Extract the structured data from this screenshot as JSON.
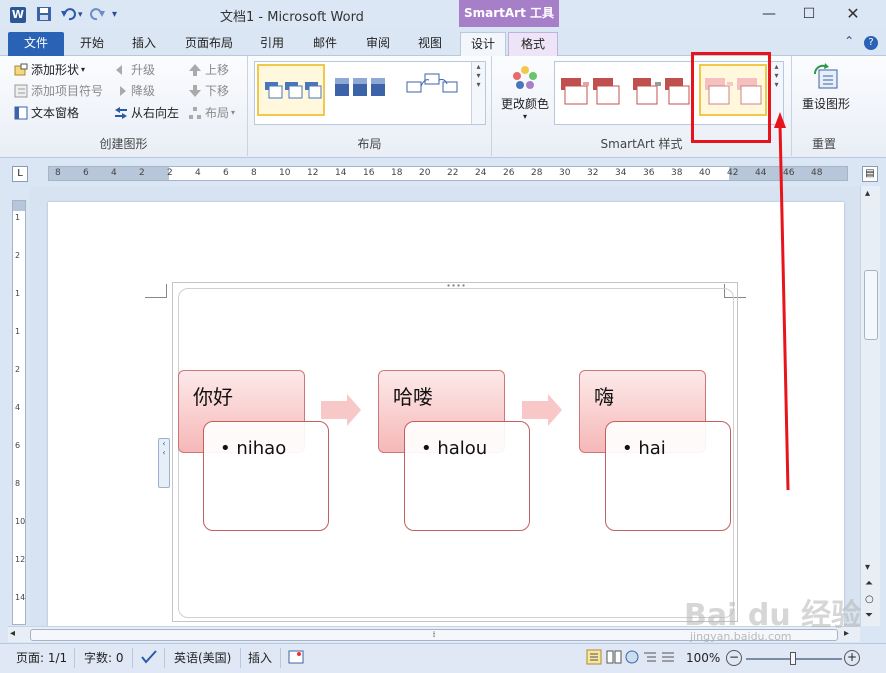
{
  "titlebar": {
    "app_icon": "W",
    "title": "文档1 - Microsoft Word",
    "context_tab": "SmartArt 工具",
    "icons": [
      "save-icon",
      "undo-icon",
      "redo-icon",
      "customize-icon"
    ]
  },
  "tabs": [
    {
      "label": "文件"
    },
    {
      "label": "开始"
    },
    {
      "label": "插入"
    },
    {
      "label": "页面布局"
    },
    {
      "label": "引用"
    },
    {
      "label": "邮件"
    },
    {
      "label": "审阅"
    },
    {
      "label": "视图"
    },
    {
      "label": "设计"
    },
    {
      "label": "格式"
    }
  ],
  "ribbon": {
    "create": {
      "label": "创建图形",
      "add_shape": "添加形状",
      "add_bullet": "添加项目符号",
      "text_pane": "文本窗格",
      "promote": "升级",
      "demote": "降级",
      "rtl": "从右向左",
      "move_up": "上移",
      "move_down": "下移",
      "layout": "布局"
    },
    "layouts": {
      "label": "布局"
    },
    "styles": {
      "label": "SmartArt 样式",
      "change_colors": "更改颜色"
    },
    "reset": {
      "label": "重置",
      "reset_graphic": "重设图形"
    }
  },
  "ruler": {
    "h_labels": [
      "8",
      "6",
      "4",
      "2",
      "2",
      "4",
      "6",
      "8",
      "10",
      "12",
      "14",
      "16",
      "18",
      "20",
      "22",
      "24",
      "26",
      "28",
      "30",
      "32",
      "34",
      "36",
      "38",
      "40",
      "42",
      "44",
      "46",
      "48"
    ],
    "v_labels": [
      "1",
      "2",
      "1",
      "1",
      "2",
      "4",
      "6",
      "8",
      "10",
      "12",
      "14"
    ]
  },
  "smartart": {
    "items": [
      {
        "title": "你好",
        "bullet": "nihao"
      },
      {
        "title": "哈喽",
        "bullet": "halou"
      },
      {
        "title": "嗨",
        "bullet": "hai"
      }
    ],
    "colors": {
      "title_fill_top": "#fde9e9",
      "title_fill_bottom": "#f6b8b8",
      "border": "#c06060",
      "arrow": "#f8c8c8"
    }
  },
  "status": {
    "page": "页面: 1/1",
    "words": "字数: 0",
    "language": "英语(美国)",
    "insert": "插入",
    "zoom": "100%"
  },
  "annotation": {
    "highlight_color": "#e8141b"
  },
  "watermark": {
    "brand": "Bai du 经验",
    "url": "jingyan.baidu.com"
  }
}
